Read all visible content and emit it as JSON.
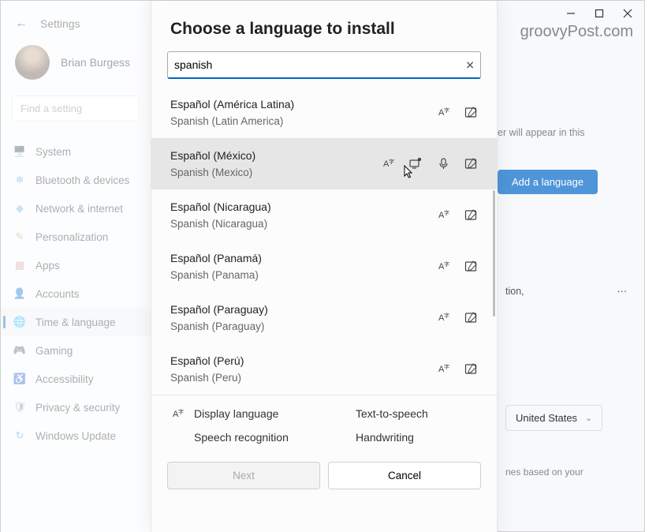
{
  "header": {
    "settings": "Settings"
  },
  "user": {
    "name": "Brian Burgess"
  },
  "watermark": "groovyPost.com",
  "search": {
    "placeholder": "Find a setting"
  },
  "nav": [
    {
      "id": "system",
      "label": "System",
      "icon": "🖥️",
      "color": "#4a90d9"
    },
    {
      "id": "bluetooth",
      "label": "Bluetooth & devices",
      "icon": "❄",
      "color": "#5aa0d8"
    },
    {
      "id": "network",
      "label": "Network & internet",
      "icon": "◆",
      "color": "#7bb3e0"
    },
    {
      "id": "personalization",
      "label": "Personalization",
      "icon": "✎",
      "color": "#bfa070"
    },
    {
      "id": "apps",
      "label": "Apps",
      "icon": "▦",
      "color": "#c98b8b"
    },
    {
      "id": "accounts",
      "label": "Accounts",
      "icon": "👤",
      "color": "#6fb8d6"
    },
    {
      "id": "time-language",
      "label": "Time & language",
      "icon": "🌐",
      "color": "#5aa0d8",
      "active": true
    },
    {
      "id": "gaming",
      "label": "Gaming",
      "icon": "🎮",
      "color": "#8bb37b"
    },
    {
      "id": "accessibility",
      "label": "Accessibility",
      "icon": "♿",
      "color": "#6fb8d6"
    },
    {
      "id": "privacy",
      "label": "Privacy & security",
      "icon": "🛡",
      "color": "#888"
    },
    {
      "id": "update",
      "label": "Windows Update",
      "icon": "↻",
      "color": "#5aa0d8"
    }
  ],
  "bg": {
    "hint1": "er will appear in this",
    "add_language": "Add a language",
    "lang_row": "tion,",
    "region": "United States",
    "hint2": "nes based on your"
  },
  "dialog": {
    "title": "Choose a language to install",
    "query": "spanish",
    "results": [
      {
        "native": "Español (América Latina)",
        "english": "Spanish (Latin America)",
        "features": [
          "display",
          "handwriting"
        ]
      },
      {
        "native": "Español (México)",
        "english": "Spanish (Mexico)",
        "features": [
          "display",
          "tts",
          "speech",
          "handwriting"
        ],
        "selected": true
      },
      {
        "native": "Español (Nicaragua)",
        "english": "Spanish (Nicaragua)",
        "features": [
          "display",
          "handwriting"
        ]
      },
      {
        "native": "Español (Panamá)",
        "english": "Spanish (Panama)",
        "features": [
          "display",
          "handwriting"
        ]
      },
      {
        "native": "Español (Paraguay)",
        "english": "Spanish (Paraguay)",
        "features": [
          "display",
          "handwriting"
        ]
      },
      {
        "native": "Español (Perú)",
        "english": "Spanish (Peru)",
        "features": [
          "display",
          "handwriting"
        ]
      }
    ],
    "legend": {
      "display": "Display language",
      "tts": "Text-to-speech",
      "speech": "Speech recognition",
      "handwriting": "Handwriting"
    },
    "next": "Next",
    "cancel": "Cancel"
  }
}
